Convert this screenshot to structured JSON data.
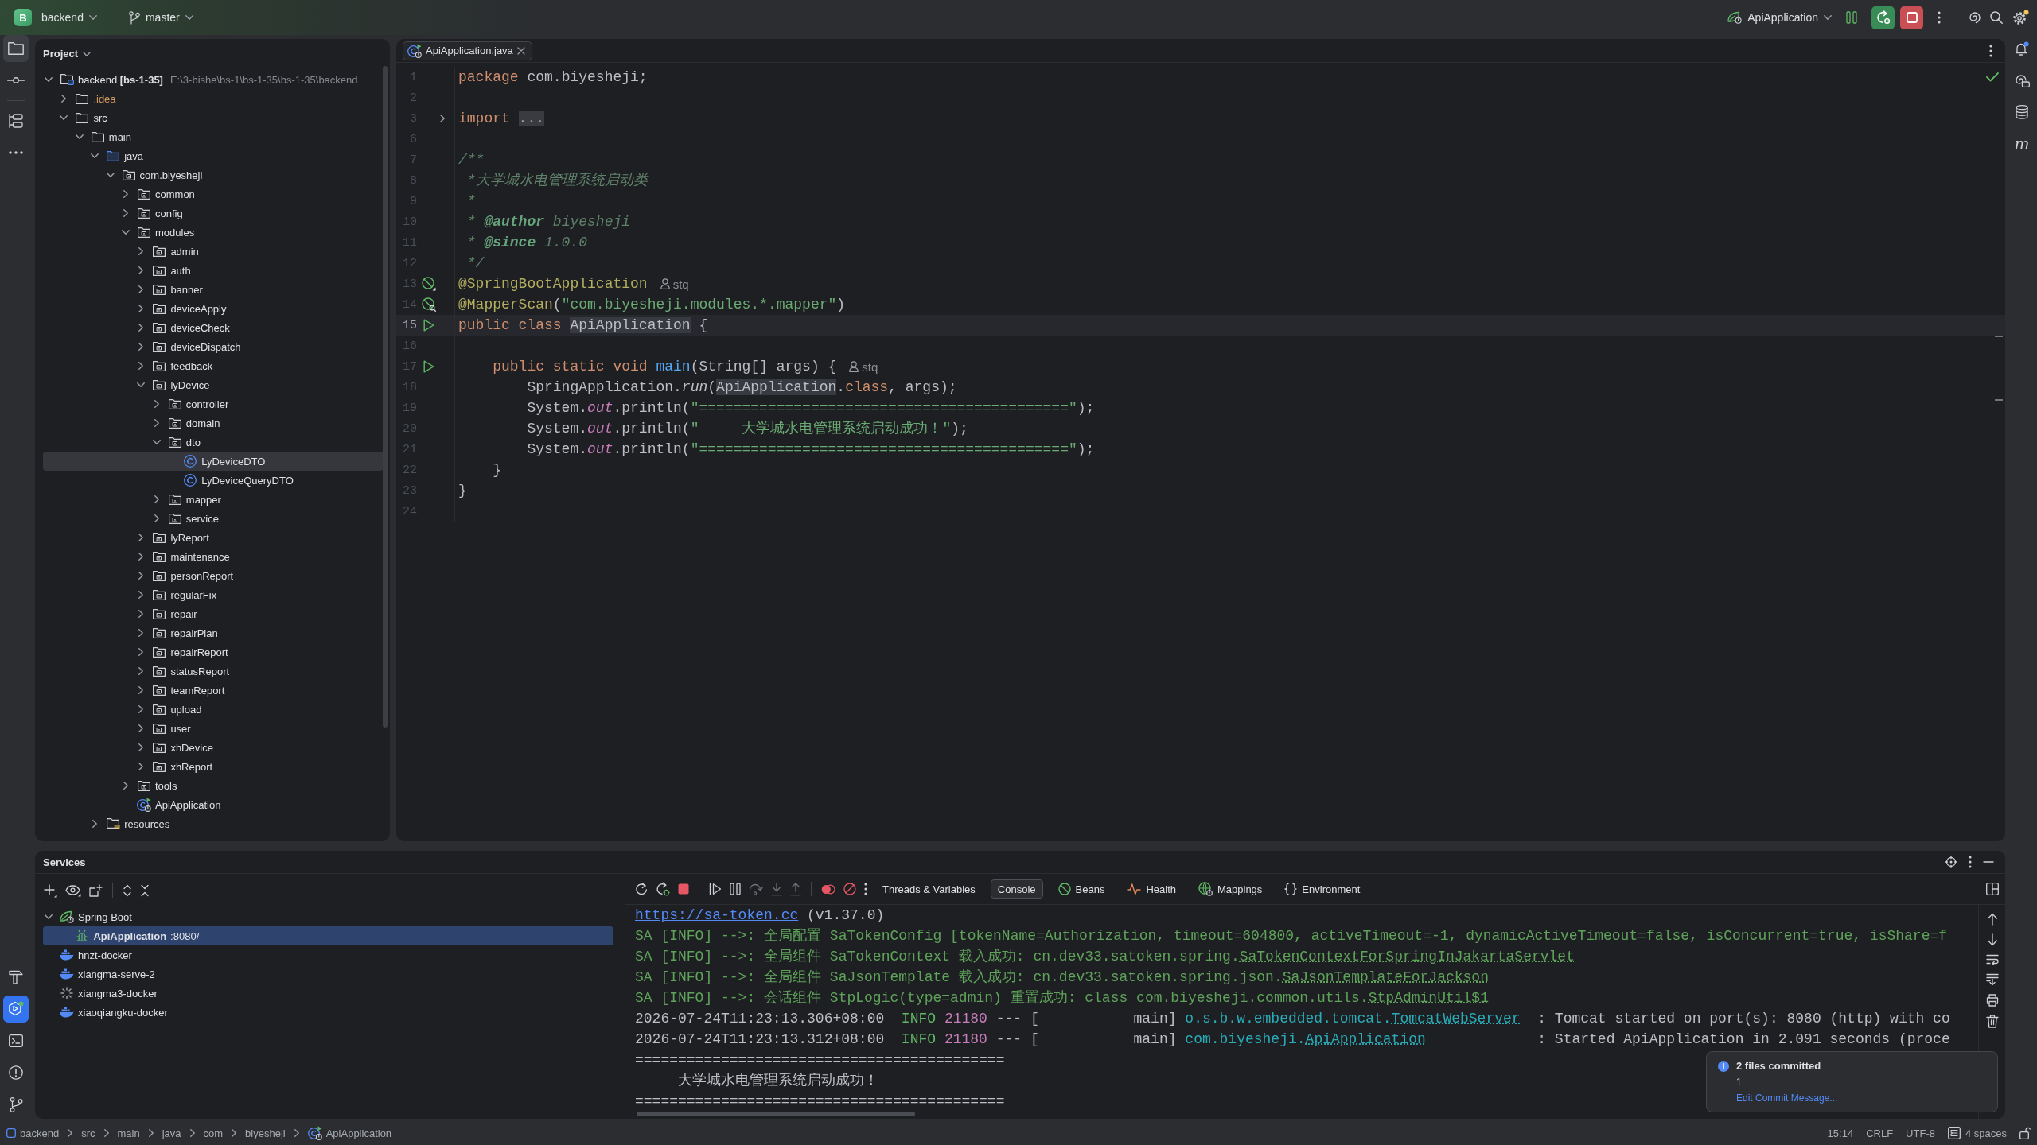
{
  "title_bar": {
    "project_badge": "B",
    "project": "backend",
    "branch": "master",
    "run_configuration": "ApiApplication"
  },
  "left_toolbar": {
    "top": [
      {
        "kind": "project",
        "selected": true,
        "focused": false
      },
      {
        "kind": "commit",
        "selected": false,
        "focused": false
      },
      {
        "kind": "structure",
        "selected": false,
        "focused": false
      },
      {
        "kind": "more",
        "selected": false,
        "focused": false
      }
    ],
    "bottom": [
      {
        "kind": "build",
        "selected": false,
        "focused": false
      },
      {
        "kind": "services",
        "selected": true,
        "focused": true
      },
      {
        "kind": "terminal",
        "selected": false,
        "focused": false
      },
      {
        "kind": "problems",
        "selected": false,
        "focused": false
      },
      {
        "kind": "git",
        "selected": false,
        "focused": false
      }
    ]
  },
  "right_toolbar": [
    {
      "kind": "notifications",
      "selected": false
    },
    {
      "kind": "ai_chat",
      "selected": false
    },
    {
      "kind": "database",
      "selected": false
    },
    {
      "kind": "maven",
      "glyph": "m",
      "selected": false
    }
  ],
  "project_panel": {
    "title": "Project",
    "tree": [
      {
        "label": "backend **[bs-1-35]**",
        "path": "E:\\3-bishe\\bs-1\\bs-1-35\\bs-1-35\\backend",
        "kind": "module",
        "expanded": true,
        "selected": false,
        "children": [
          {
            "label": ".idea",
            "kind": "ignored_folder",
            "expanded": false,
            "selected": false
          },
          {
            "label": "src",
            "kind": "folder",
            "expanded": true,
            "selected": false,
            "children": [
              {
                "label": "main",
                "kind": "folder",
                "expanded": true,
                "selected": false,
                "children": [
                  {
                    "label": "java",
                    "kind": "source_root",
                    "expanded": true,
                    "selected": false,
                    "children": [
                      {
                        "label": "com.biyesheji",
                        "kind": "package",
                        "expanded": true,
                        "selected": false,
                        "children": [
                          {
                            "label": "common",
                            "kind": "package",
                            "expanded": false,
                            "selected": false
                          },
                          {
                            "label": "config",
                            "kind": "package",
                            "expanded": false,
                            "selected": false
                          },
                          {
                            "label": "modules",
                            "kind": "package",
                            "expanded": true,
                            "selected": false,
                            "children": [
                              {
                                "label": "admin",
                                "kind": "package",
                                "expanded": false,
                                "selected": false
                              },
                              {
                                "label": "auth",
                                "kind": "package",
                                "expanded": false,
                                "selected": false
                              },
                              {
                                "label": "banner",
                                "kind": "package",
                                "expanded": false,
                                "selected": false
                              },
                              {
                                "label": "deviceApply",
                                "kind": "package",
                                "expanded": false,
                                "selected": false
                              },
                              {
                                "label": "deviceCheck",
                                "kind": "package",
                                "expanded": false,
                                "selected": false
                              },
                              {
                                "label": "deviceDispatch",
                                "kind": "package",
                                "expanded": false,
                                "selected": false
                              },
                              {
                                "label": "feedback",
                                "kind": "package",
                                "expanded": false,
                                "selected": false
                              },
                              {
                                "label": "lyDevice",
                                "kind": "package",
                                "expanded": true,
                                "selected": false,
                                "children": [
                                  {
                                    "label": "controller",
                                    "kind": "package",
                                    "expanded": false,
                                    "selected": false
                                  },
                                  {
                                    "label": "domain",
                                    "kind": "package",
                                    "expanded": false,
                                    "selected": false
                                  },
                                  {
                                    "label": "dto",
                                    "kind": "package",
                                    "expanded": true,
                                    "selected": false,
                                    "children": [
                                      {
                                        "label": "LyDeviceDTO",
                                        "kind": "class",
                                        "selected": true
                                      },
                                      {
                                        "label": "LyDeviceQueryDTO",
                                        "kind": "class",
                                        "selected": false
                                      }
                                    ]
                                  },
                                  {
                                    "label": "mapper",
                                    "kind": "package",
                                    "expanded": false,
                                    "selected": false
                                  },
                                  {
                                    "label": "service",
                                    "kind": "package",
                                    "expanded": false,
                                    "selected": false
                                  }
                                ]
                              },
                              {
                                "label": "lyReport",
                                "kind": "package",
                                "expanded": false,
                                "selected": false
                              },
                              {
                                "label": "maintenance",
                                "kind": "package",
                                "expanded": false,
                                "selected": false
                              },
                              {
                                "label": "personReport",
                                "kind": "package",
                                "expanded": false,
                                "selected": false
                              },
                              {
                                "label": "regularFix",
                                "kind": "package",
                                "expanded": false,
                                "selected": false
                              },
                              {
                                "label": "repair",
                                "kind": "package",
                                "expanded": false,
                                "selected": false
                              },
                              {
                                "label": "repairPlan",
                                "kind": "package",
                                "expanded": false,
                                "selected": false
                              },
                              {
                                "label": "repairReport",
                                "kind": "package",
                                "expanded": false,
                                "selected": false
                              },
                              {
                                "label": "statusReport",
                                "kind": "package",
                                "expanded": false,
                                "selected": false
                              },
                              {
                                "label": "teamReport",
                                "kind": "package",
                                "expanded": false,
                                "selected": false
                              },
                              {
                                "label": "upload",
                                "kind": "package",
                                "expanded": false,
                                "selected": false
                              },
                              {
                                "label": "user",
                                "kind": "package",
                                "expanded": false,
                                "selected": false
                              },
                              {
                                "label": "xhDevice",
                                "kind": "package",
                                "expanded": false,
                                "selected": false
                              },
                              {
                                "label": "xhReport",
                                "kind": "package",
                                "expanded": false,
                                "selected": false
                              }
                            ]
                          },
                          {
                            "label": "tools",
                            "kind": "package",
                            "expanded": false,
                            "selected": false
                          },
                          {
                            "label": "ApiApplication",
                            "kind": "app_class",
                            "selected": false
                          }
                        ]
                      }
                    ]
                  },
                  {
                    "label": "resources",
                    "kind": "resources",
                    "expanded": false,
                    "selected": false
                  }
                ]
              }
            ]
          }
        ]
      }
    ]
  },
  "editor": {
    "tabs": [
      {
        "label": "ApiApplication.java",
        "selected": true
      }
    ],
    "lines": [
      {
        "number": "1",
        "current": false,
        "tokens": [
          {
            "kind": "keyword",
            "text": "package"
          },
          {
            "kind": "plain",
            "text": " com.biyesheji;"
          }
        ]
      },
      {
        "number": "2",
        "current": false
      },
      {
        "number": "3",
        "current": false,
        "gutter": {
          "kind": "fold"
        },
        "tokens": [
          {
            "kind": "keyword",
            "text": "import"
          },
          {
            "kind": "folded",
            "text": "..."
          }
        ]
      },
      {
        "number": "6",
        "current": false
      },
      {
        "number": "7",
        "current": false,
        "tokens": [
          {
            "kind": "doc",
            "text": "/**"
          }
        ]
      },
      {
        "number": "8",
        "current": false,
        "tokens": [
          {
            "kind": "doc",
            "text": " *大学城水电管理系统启动类"
          }
        ]
      },
      {
        "number": "9",
        "current": false,
        "tokens": [
          {
            "kind": "doc",
            "text": " *"
          }
        ]
      },
      {
        "number": "10",
        "current": false,
        "tokens": [
          {
            "kind": "doc",
            "text": " * "
          },
          {
            "kind": "doc_tag",
            "text": "@author"
          },
          {
            "kind": "doc",
            "text": " biyesheji"
          }
        ]
      },
      {
        "number": "11",
        "current": false,
        "tokens": [
          {
            "kind": "doc",
            "text": " * "
          },
          {
            "kind": "doc_tag",
            "text": "@since"
          },
          {
            "kind": "doc",
            "text": " 1.0.0"
          }
        ]
      },
      {
        "number": "12",
        "current": false,
        "tokens": [
          {
            "kind": "doc",
            "text": " */"
          }
        ]
      },
      {
        "number": "13",
        "current": false,
        "gutter": {
          "kind": "bean"
        },
        "hint": "stq",
        "tokens": [
          {
            "kind": "annotation",
            "text": "@SpringBootApplication"
          }
        ]
      },
      {
        "number": "14",
        "current": false,
        "gutter": {
          "kind": "mapper"
        },
        "tokens": [
          {
            "kind": "annotation",
            "text": "@MapperScan"
          },
          {
            "kind": "plain",
            "text": "("
          },
          {
            "kind": "string",
            "text": "\"com.biyesheji.modules.*.mapper\""
          },
          {
            "kind": "plain",
            "text": ")"
          }
        ]
      },
      {
        "number": "15",
        "current": true,
        "gutter": {
          "kind": "run"
        },
        "tokens": [
          {
            "kind": "keyword",
            "text": "public class "
          },
          {
            "kind": "usage",
            "text": "ApiApplication"
          },
          {
            "kind": "plain",
            "text": " {"
          }
        ]
      },
      {
        "number": "16",
        "current": false
      },
      {
        "number": "17",
        "current": false,
        "gutter": {
          "kind": "run"
        },
        "hint": "stq",
        "tokens": [
          {
            "kind": "keyword",
            "text": "    public static void "
          },
          {
            "kind": "method",
            "text": "main"
          },
          {
            "kind": "plain",
            "text": "(String[] args) {"
          }
        ]
      },
      {
        "number": "18",
        "current": false,
        "tokens": [
          {
            "kind": "plain",
            "text": "        SpringApplication."
          },
          {
            "kind": "static_call",
            "text": "run"
          },
          {
            "kind": "plain",
            "text": "("
          },
          {
            "kind": "usage",
            "text": "ApiApplication"
          },
          {
            "kind": "plain",
            "text": "."
          },
          {
            "kind": "keyword",
            "text": "class"
          },
          {
            "kind": "plain",
            "text": ", args);"
          }
        ]
      },
      {
        "number": "19",
        "current": false,
        "tokens": [
          {
            "kind": "plain",
            "text": "        System."
          },
          {
            "kind": "static_field",
            "text": "out"
          },
          {
            "kind": "plain",
            "text": ".println("
          },
          {
            "kind": "string",
            "text": "\"===========================================\""
          },
          {
            "kind": "plain",
            "text": ");"
          }
        ]
      },
      {
        "number": "20",
        "current": false,
        "tokens": [
          {
            "kind": "plain",
            "text": "        System."
          },
          {
            "kind": "static_field",
            "text": "out"
          },
          {
            "kind": "plain",
            "text": ".println("
          },
          {
            "kind": "string",
            "text": "\"     大学城水电管理系统启动成功！\""
          },
          {
            "kind": "plain",
            "text": ");"
          }
        ]
      },
      {
        "number": "21",
        "current": false,
        "tokens": [
          {
            "kind": "plain",
            "text": "        System."
          },
          {
            "kind": "static_field",
            "text": "out"
          },
          {
            "kind": "plain",
            "text": ".println("
          },
          {
            "kind": "string",
            "text": "\"===========================================\""
          },
          {
            "kind": "plain",
            "text": ");"
          }
        ]
      },
      {
        "number": "22",
        "current": false,
        "tokens": [
          {
            "kind": "plain",
            "text": "    }"
          }
        ]
      },
      {
        "number": "23",
        "current": false,
        "tokens": [
          {
            "kind": "plain",
            "text": "}"
          }
        ]
      },
      {
        "number": "24",
        "current": false
      }
    ]
  },
  "services": {
    "title": "Services",
    "tree": [
      {
        "label": "Spring Boot",
        "kind": "spring",
        "expanded": true,
        "selected": false,
        "running": false,
        "children": [
          {
            "label": "ApiApplication",
            "port": ":8080/",
            "kind": "debug_app",
            "selected": true,
            "running": true
          }
        ]
      },
      {
        "label": "hnzt-docker",
        "kind": "docker",
        "selected": false,
        "running": false
      },
      {
        "label": "xiangma-serve-2",
        "kind": "docker",
        "selected": false,
        "running": false
      },
      {
        "label": "xiangma3-docker",
        "kind": "loading",
        "selected": false,
        "running": false
      },
      {
        "label": "xiaoqiangku-docker",
        "kind": "docker",
        "selected": false,
        "running": false
      }
    ],
    "console": {
      "tabs": [
        {
          "label": "Threads & Variables",
          "kind": "threads",
          "selected": false
        },
        {
          "label": "Console",
          "kind": "console",
          "selected": true
        },
        {
          "label": "Beans",
          "kind": "beans",
          "selected": false
        },
        {
          "label": "Health",
          "kind": "health",
          "selected": false
        },
        {
          "label": "Mappings",
          "kind": "mappings",
          "selected": false
        },
        {
          "label": "Environment",
          "kind": "environment",
          "selected": false
        }
      ],
      "lines": [
        {
          "tokens": [
            {
              "kind": "url",
              "text": "https://sa-token.cc"
            },
            {
              "kind": "plain",
              "text": " (v1.37.0)"
            }
          ]
        },
        {
          "tokens": [
            {
              "kind": "sa",
              "text": "SA [INFO] -->: 全局配置 SaTokenConfig [tokenName=Authorization, timeout=604800, activeTimeout=-1, dynamicActiveTimeout=false, isConcurrent=true, isShare=f"
            }
          ]
        },
        {
          "tokens": [
            {
              "kind": "sa",
              "text": "SA [INFO] -->: 全局组件 SaTokenContext 载入成功: cn.dev33.satoken.spring."
            },
            {
              "kind": "sa_link",
              "text": "SaTokenContextForSpringInJakartaServlet"
            }
          ]
        },
        {
          "tokens": [
            {
              "kind": "sa",
              "text": "SA [INFO] -->: 全局组件 SaJsonTemplate 载入成功: cn.dev33.satoken.spring.json."
            },
            {
              "kind": "sa_link",
              "text": "SaJsonTemplateForJackson"
            }
          ]
        },
        {
          "tokens": [
            {
              "kind": "sa",
              "text": "SA [INFO] -->: 会话组件 StpLogic(type=admin) 重置成功: class com.biyesheji.common.utils."
            },
            {
              "kind": "sa_link",
              "text": "StpAdminUtil$1"
            }
          ]
        },
        {
          "tokens": [
            {
              "kind": "plain",
              "text": "2026-07-24T11:23:13.306+08:00  "
            },
            {
              "kind": "level",
              "text": "INFO"
            },
            {
              "kind": "pid",
              "text": " 21180"
            },
            {
              "kind": "plain",
              "text": " --- [           main] "
            },
            {
              "kind": "logger",
              "text": "o.s.b.w.embedded.tomcat."
            },
            {
              "kind": "logger_link",
              "text": "TomcatWebServer"
            },
            {
              "kind": "plain",
              "text": "  : Tomcat started on port(s): 8080 (http) with co"
            }
          ]
        },
        {
          "tokens": [
            {
              "kind": "plain",
              "text": "2026-07-24T11:23:13.312+08:00  "
            },
            {
              "kind": "level",
              "text": "INFO"
            },
            {
              "kind": "pid",
              "text": " 21180"
            },
            {
              "kind": "plain",
              "text": " --- [           main] "
            },
            {
              "kind": "logger",
              "text": "com.biyesheji."
            },
            {
              "kind": "logger_link",
              "text": "ApiApplication"
            },
            {
              "kind": "plain",
              "text": "             : Started ApiApplication in 2.091 seconds (proce"
            }
          ]
        },
        {
          "tokens": [
            {
              "kind": "plain",
              "text": "==========================================="
            }
          ]
        },
        {
          "tokens": [
            {
              "kind": "plain",
              "text": "     大学城水电管理系统启动成功！"
            }
          ]
        },
        {
          "tokens": [
            {
              "kind": "plain",
              "text": "==========================================="
            }
          ]
        }
      ]
    }
  },
  "notification": {
    "title": "2 files committed",
    "body": "1",
    "action": "Edit Commit Message..."
  },
  "status_bar": {
    "breadcrumbs": [
      {
        "label": "backend",
        "kind": "module"
      },
      {
        "label": "src",
        "kind": "folder"
      },
      {
        "label": "main",
        "kind": "folder"
      },
      {
        "label": "java",
        "kind": "folder"
      },
      {
        "label": "com",
        "kind": "folder"
      },
      {
        "label": "biyesheji",
        "kind": "folder"
      },
      {
        "label": "ApiApplication",
        "kind": "app_class"
      }
    ],
    "caret": "15:14",
    "line_separator": "CRLF",
    "encoding": "UTF-8",
    "indent": "4 spaces"
  }
}
